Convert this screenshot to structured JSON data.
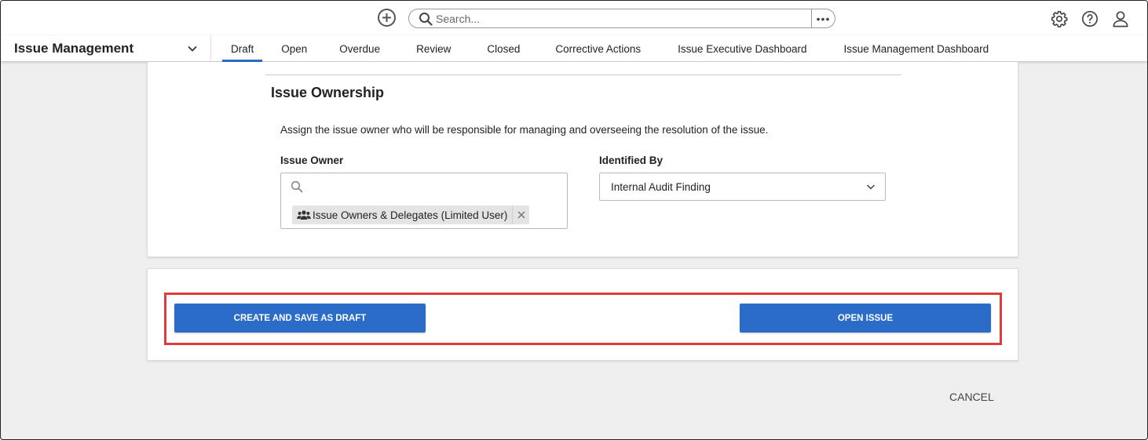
{
  "topbar": {
    "add_icon": "plus-circle-icon",
    "search_placeholder": "Search...",
    "search_more": "•••",
    "icons": [
      "gear-icon",
      "help-icon",
      "user-icon"
    ]
  },
  "navbar": {
    "app_title": "Issue Management",
    "tabs": [
      {
        "label": "Draft",
        "active": true
      },
      {
        "label": "Open"
      },
      {
        "label": "Overdue"
      },
      {
        "label": "Review"
      },
      {
        "label": "Closed"
      },
      {
        "label": "Corrective Actions"
      },
      {
        "label": "Issue Executive Dashboard"
      },
      {
        "label": "Issue Management Dashboard"
      }
    ]
  },
  "form": {
    "section_title": "Issue Ownership",
    "description": "Assign the issue owner who will be responsible for managing and overseeing the resolution of the issue.",
    "issue_owner_label": "Issue Owner",
    "issue_owner_chip": "Issue Owners & Delegates (Limited User)",
    "identified_by_label": "Identified By",
    "identified_by_value": "Internal Audit Finding"
  },
  "actions": {
    "create_draft": "CREATE AND SAVE AS DRAFT",
    "open_issue": "OPEN ISSUE",
    "cancel": "CANCEL"
  },
  "colors": {
    "accent": "#2a6cc7",
    "highlight": "#e23b3b"
  }
}
